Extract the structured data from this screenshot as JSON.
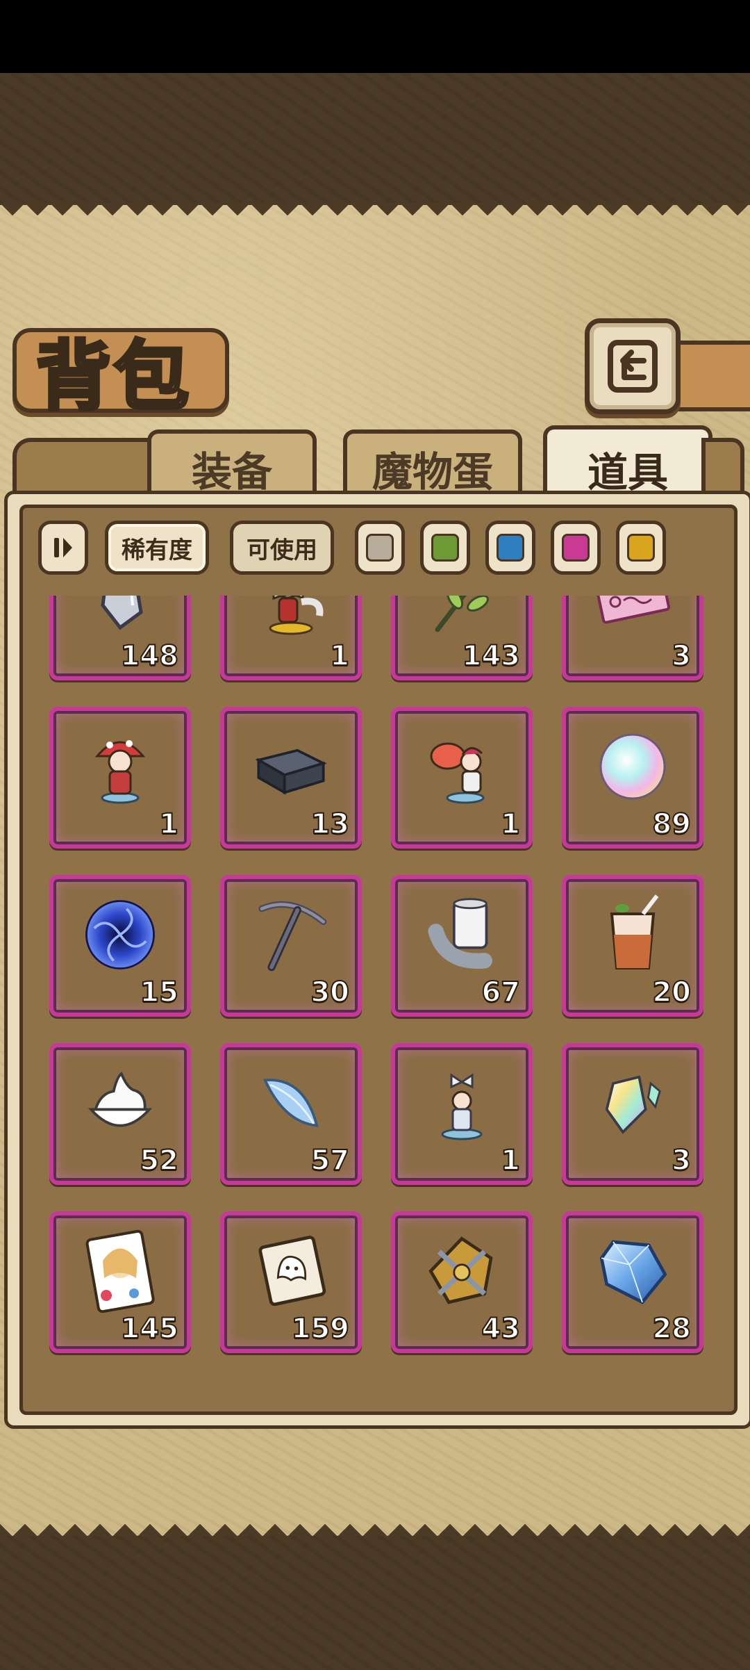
{
  "title": "背包",
  "tabs": [
    {
      "label": "装备",
      "active": false
    },
    {
      "label": "魔物蛋",
      "active": false
    },
    {
      "label": "道具",
      "active": true
    }
  ],
  "filters": {
    "rarity_label": "稀有度",
    "usable_label": "可使用",
    "swatches": [
      "#b7ad9a",
      "#6e9a35",
      "#2e7fbf",
      "#c83a93",
      "#d9a51f"
    ]
  },
  "colors": {
    "slot_border": "#c8389b",
    "panel": "#8f7248"
  },
  "items": [
    {
      "icon": "crystal-shard-icon",
      "count": "148"
    },
    {
      "icon": "character-figure-icon",
      "count": "1"
    },
    {
      "icon": "leaf-branch-icon",
      "count": "143"
    },
    {
      "icon": "ticket-icon",
      "count": "3"
    },
    {
      "icon": "mushroom-girl-figure-icon",
      "count": "1"
    },
    {
      "icon": "iron-ingot-icon",
      "count": "13"
    },
    {
      "icon": "flower-girl-figure-icon",
      "count": "1"
    },
    {
      "icon": "rainbow-fluff-icon",
      "count": "89"
    },
    {
      "icon": "blue-vortex-icon",
      "count": "15"
    },
    {
      "icon": "pickaxe-icon",
      "count": "30"
    },
    {
      "icon": "toilet-paper-icon",
      "count": "67"
    },
    {
      "icon": "iced-drink-icon",
      "count": "20"
    },
    {
      "icon": "whipped-cream-icon",
      "count": "52"
    },
    {
      "icon": "blue-feather-icon",
      "count": "57"
    },
    {
      "icon": "bow-figure-icon",
      "count": "1"
    },
    {
      "icon": "prism-crystal-icon",
      "count": "3"
    },
    {
      "icon": "character-card-icon",
      "count": "145"
    },
    {
      "icon": "ghost-card-icon",
      "count": "159"
    },
    {
      "icon": "golden-emblem-icon",
      "count": "43"
    },
    {
      "icon": "blue-gem-icon",
      "count": "28"
    }
  ]
}
